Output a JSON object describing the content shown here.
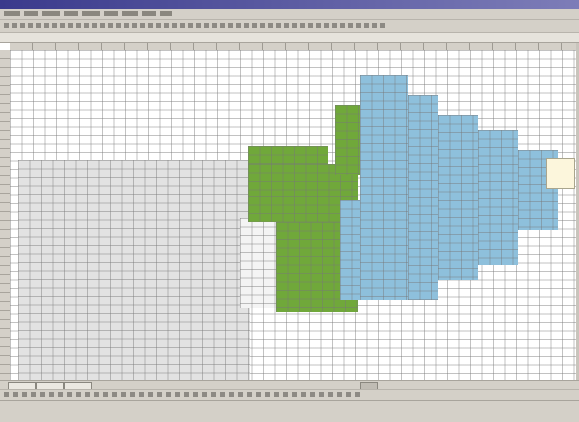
{
  "window": {
    "title": "",
    "accent": "#3a3a8c"
  },
  "menubar": {
    "items": [
      "",
      "",
      "",
      "",
      "",
      "",
      "",
      "",
      ""
    ]
  },
  "toolbar": {
    "button_icons": [
      "toolbar-button-icon"
    ]
  },
  "formula_bar": {
    "cell_ref": "",
    "content": ""
  },
  "sheet": {
    "colors": {
      "green": "#70a83a",
      "blue": "#8ec0dc",
      "gray": "#e2e2e2",
      "note": "#fcf6dc"
    }
  },
  "sheet_tabs": [
    "",
    "",
    ""
  ],
  "status": {
    "text": ""
  }
}
